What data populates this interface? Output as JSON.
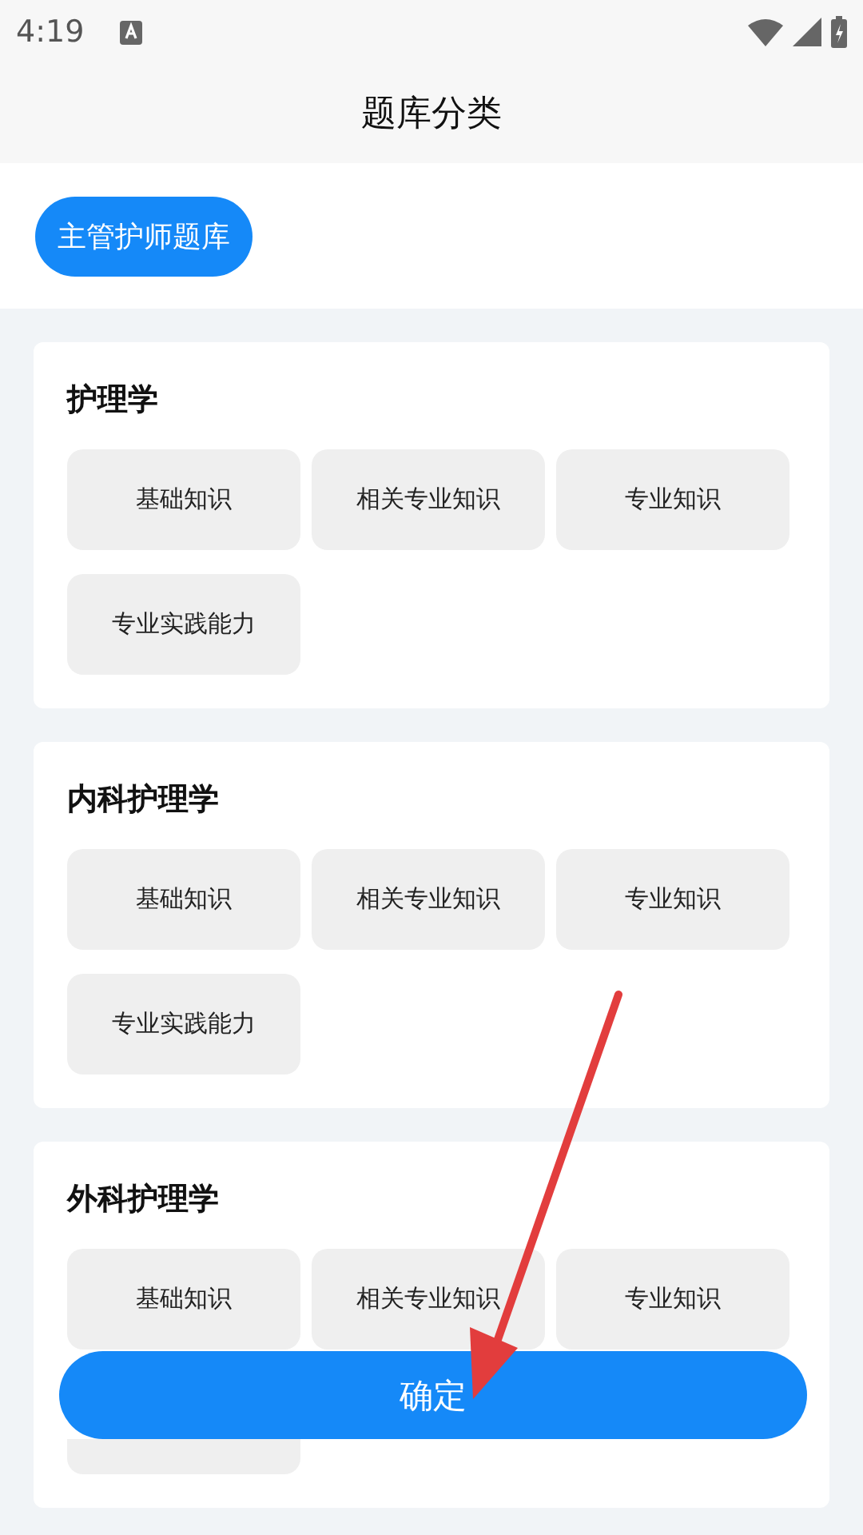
{
  "status_bar": {
    "time": "4:19"
  },
  "title": "题库分类",
  "banks": [
    {
      "label": "主管护师题库",
      "selected": true
    }
  ],
  "sections": [
    {
      "title": "护理学",
      "items": [
        {
          "label": "基础知识",
          "selected": false
        },
        {
          "label": "相关专业知识",
          "selected": false
        },
        {
          "label": "专业知识",
          "selected": false
        },
        {
          "label": "专业实践能力",
          "selected": false
        }
      ]
    },
    {
      "title": "内科护理学",
      "items": [
        {
          "label": "基础知识",
          "selected": false
        },
        {
          "label": "相关专业知识",
          "selected": false
        },
        {
          "label": "专业知识",
          "selected": false
        },
        {
          "label": "专业实践能力",
          "selected": false
        }
      ]
    },
    {
      "title": "外科护理学",
      "items": [
        {
          "label": "基础知识",
          "selected": false
        },
        {
          "label": "相关专业知识",
          "selected": false
        },
        {
          "label": "专业知识",
          "selected": false
        },
        {
          "selected": false
        }
      ]
    }
  ],
  "confirm_button": "确定"
}
